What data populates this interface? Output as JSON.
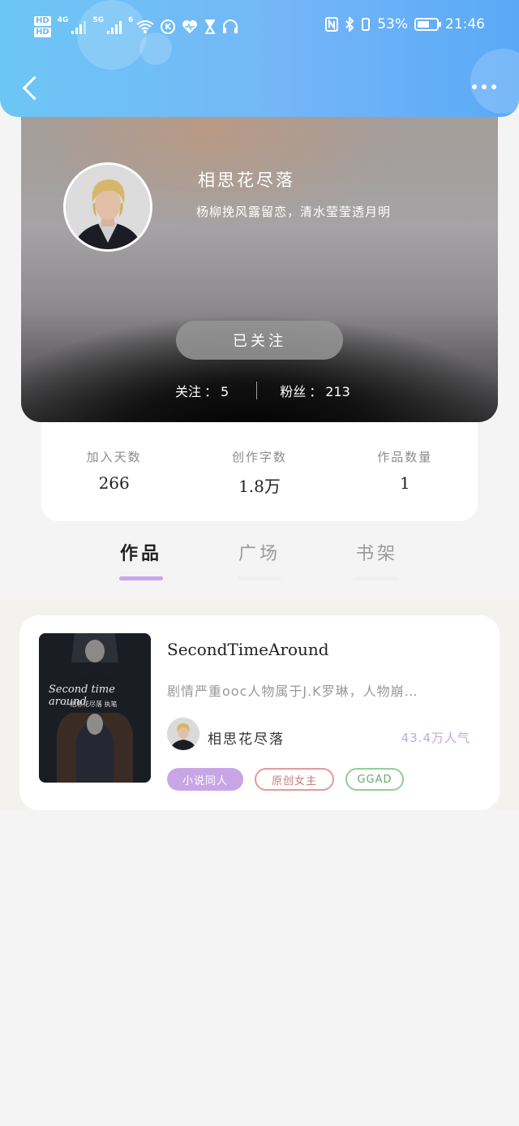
{
  "status_bar": {
    "hd1": "HD",
    "hd2": "HD",
    "net1": "4G",
    "net2": "5G",
    "wifi_num": "6",
    "battery_pct": "53%",
    "time": "21:46"
  },
  "profile": {
    "name": "相思花尽落",
    "bio": "杨柳挽风露留恋，清水莹莹透月明",
    "follow_button": "已关注",
    "following_label": "关注",
    "following_count": "5",
    "fans_label": "粉丝",
    "fans_count": "213"
  },
  "stats": [
    {
      "label": "加入天数",
      "value": "266"
    },
    {
      "label": "创作字数",
      "value": "1.8万"
    },
    {
      "label": "作品数量",
      "value": "1"
    }
  ],
  "tabs": [
    {
      "label": "作品",
      "active": true
    },
    {
      "label": "广场",
      "active": false
    },
    {
      "label": "书架",
      "active": false
    }
  ],
  "work": {
    "title": "SecondTimeAround",
    "description": "剧情严重ooc人物属于J.K罗琳，人物崩…",
    "author": "相思花尽落",
    "popularity": "43.4万人气",
    "cover_title": "Second time around",
    "cover_subtitle": "—相思花尽落 执笔",
    "tags": [
      "小说同人",
      "原创女主",
      "GGAD"
    ]
  },
  "colors": {
    "header_blue": "#6cc6f5",
    "accent_purple": "#c7a8e8",
    "tag_red": "#e49a9a",
    "tag_green": "#8fcf9a"
  }
}
